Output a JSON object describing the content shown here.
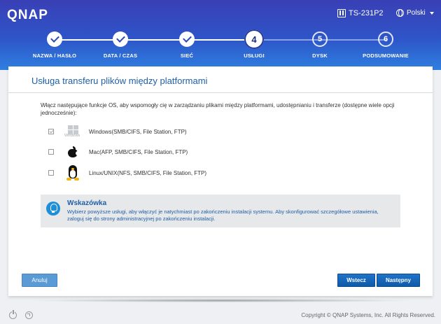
{
  "header": {
    "logo": "QNAP",
    "model": "TS-231P2",
    "language": "Polski"
  },
  "steps": [
    {
      "label": "NAZWA / HASŁO",
      "state": "done"
    },
    {
      "label": "DATA / CZAS",
      "state": "done"
    },
    {
      "label": "SIEĆ",
      "state": "done"
    },
    {
      "label": "USŁUGI",
      "state": "current",
      "number": "4"
    },
    {
      "label": "DYSK",
      "state": "future",
      "number": "5"
    },
    {
      "label": "PODSUMOWANIE",
      "state": "future",
      "number": "6"
    }
  ],
  "panel": {
    "title": "Usługa transferu plików między platformami",
    "description": "Włącz następujące funkcje OS, aby wspomogły cię w zarządzaniu plikami między platformami, udostępnianiu i transferze (dostępne wiele opcji jednocześnie):",
    "options": [
      {
        "label": "Windows(SMB/CIFS, File Station, FTP)",
        "checked": true,
        "icon": "windows-icon",
        "icon_text": "Windows"
      },
      {
        "label": "Mac(AFP, SMB/CIFS, File Station, FTP)",
        "checked": false,
        "icon": "apple-icon"
      },
      {
        "label": "Linux/UNIX(NFS, SMB/CIFS, File Station, FTP)",
        "checked": false,
        "icon": "linux-tux-icon"
      }
    ],
    "tip": {
      "title": "Wskazówka",
      "text": "Wybierz powyższe usługi, aby włączyć je natychmiast po zakończeniu instalacji systemu. Aby skonfigurować szczegółowe ustawienia, zaloguj się do strony administracyjnej po zakończeniu instalacji."
    },
    "buttons": {
      "cancel": "Anuluj",
      "back": "Wstecz",
      "next": "Następny"
    }
  },
  "footer": {
    "copyright": "Copyright © QNAP Systems, Inc. All Rights Reserved."
  },
  "colors": {
    "header_top": "#3a3fb5",
    "header_bottom": "#2f7fe0",
    "title_blue": "#1e5fa8",
    "button_blue": "#1f73c9"
  }
}
